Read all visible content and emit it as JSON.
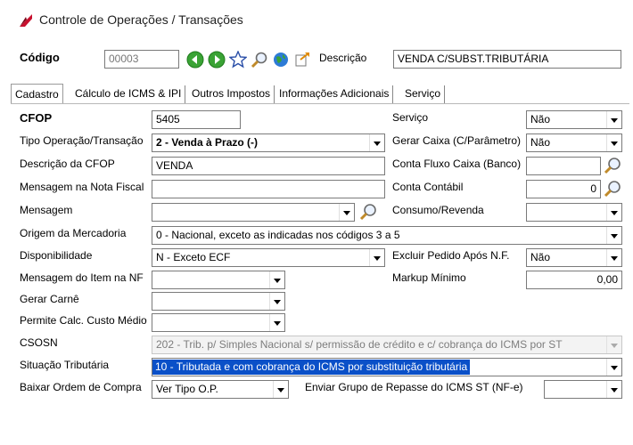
{
  "window": {
    "title": "Controle de Operações / Transações"
  },
  "header": {
    "codigo_label": "Código",
    "codigo_value": "00003",
    "descricao_label": "Descrição",
    "descricao_value": "VENDA C/SUBST.TRIBUTÁRIA"
  },
  "tabs": [
    {
      "label": "Cadastro",
      "active": true
    },
    {
      "label": "Cálculo de ICMS & IPI",
      "active": false
    },
    {
      "label": "Outros Impostos",
      "active": false
    },
    {
      "label": "Informações Adicionais",
      "active": false
    },
    {
      "label": "Serviço",
      "active": false
    }
  ],
  "form": {
    "cfop_label": "CFOP",
    "cfop_value": "5405",
    "tipo_operacao_label": "Tipo Operação/Transação",
    "tipo_operacao_value": "2 - Venda à Prazo (-)",
    "descricao_cfop_label": "Descrição da CFOP",
    "descricao_cfop_value": "VENDA",
    "mensagem_nf_label": "Mensagem na Nota Fiscal",
    "mensagem_nf_value": "",
    "mensagem_label": "Mensagem",
    "mensagem_value": "",
    "origem_label": "Origem da Mercadoria",
    "origem_value": "0 - Nacional, exceto as indicadas nos códigos 3 a 5",
    "disponibilidade_label": "Disponibilidade",
    "disponibilidade_value": "N - Exceto ECF",
    "mensagem_item_label": "Mensagem do Item na NF",
    "mensagem_item_value": "",
    "gerar_carne_label": "Gerar Carnê",
    "gerar_carne_value": "",
    "custo_medio_label": "Permite Calc. Custo Médio",
    "custo_medio_value": "",
    "csosn_label": "CSOSN",
    "csosn_value": "202 - Trib. p/ Simples Nacional s/ permissão de crédito e c/ cobrança do ICMS por ST",
    "situacao_label": "Situação Tributária",
    "situacao_value": "10 - Tributada e com cobrança do ICMS por substituição tributária",
    "baixar_ordem_label": "Baixar Ordem de Compra",
    "baixar_ordem_value": "Ver Tipo O.P.",
    "servico_label": "Serviço",
    "servico_value": "Não",
    "gerar_caixa_label": "Gerar Caixa (C/Parâmetro)",
    "gerar_caixa_value": "Não",
    "conta_fluxo_label": "Conta Fluxo Caixa (Banco)",
    "conta_fluxo_value": "",
    "conta_contabil_label": "Conta Contábil",
    "conta_contabil_value": "0",
    "consumo_revenda_label": "Consumo/Revenda",
    "consumo_revenda_value": "",
    "excluir_pedido_label": "Excluir Pedido Após N.F.",
    "excluir_pedido_value": "Não",
    "markup_label": "Markup Mínimo",
    "markup_value": "0,00",
    "enviar_grupo_label": "Enviar Grupo de Repasse do ICMS ST (NF-e)",
    "enviar_grupo_value": ""
  },
  "colors": {
    "selection": "#0a50c8",
    "logo_red": "#c8102e",
    "nav_green": "#3aa335"
  }
}
